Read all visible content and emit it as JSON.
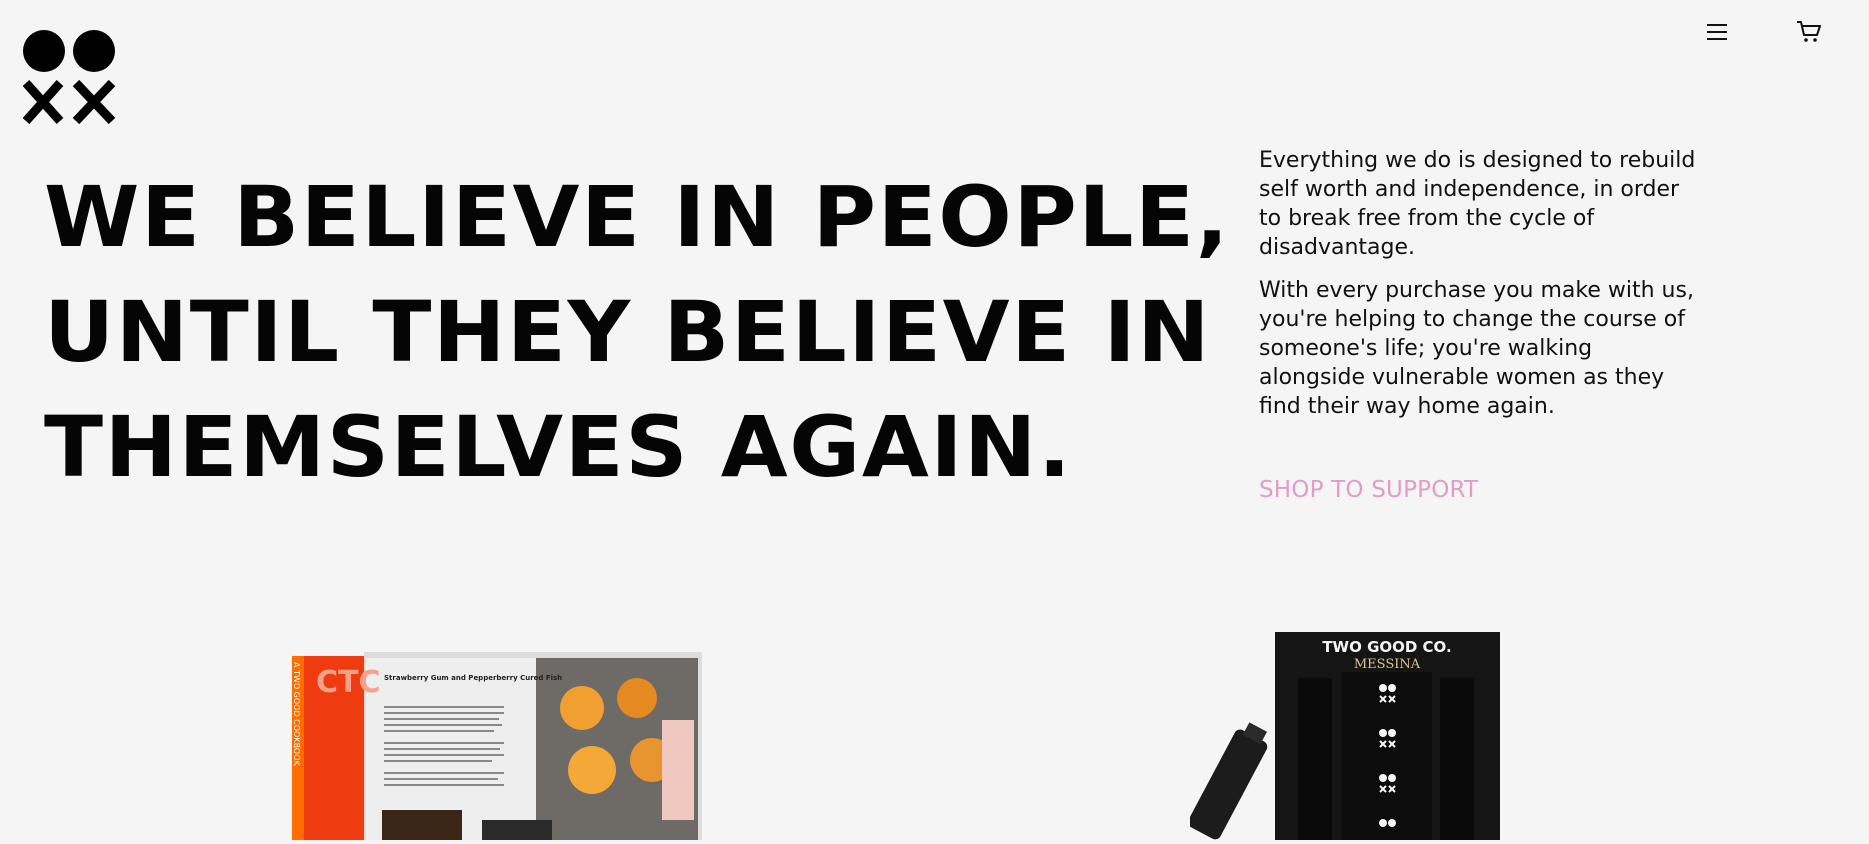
{
  "header": {
    "logo_icon": "two-good-co-logo",
    "menu_icon": "hamburger-menu-icon",
    "cart_icon": "shopping-cart-icon"
  },
  "hero": {
    "headline_lines": [
      "WE BELIEVE IN PEOPLE,",
      "UNTIL THEY BELIEVE IN",
      "THEMSELVES AGAIN."
    ],
    "paragraphs": [
      "Everything we do is designed to rebuild self worth and independence, in order to break free from the cycle of disadvantage.",
      "With every purchase you make with us, you're helping to change the course of someone's life; you're walking alongside vulnerable women as they find their way home again."
    ],
    "cta_label": "SHOP TO SUPPORT",
    "cta_color": "#e59bc7"
  },
  "products": {
    "cookbook": {
      "spine_text": "A TWO GOOD COOKBOOK",
      "cover_letters": "CTC",
      "recipe_title": "Strawberry Gum and Pepperberry Cured Fish"
    },
    "gift_box": {
      "brand": "TWO GOOD CO.",
      "partner": "MESSINA"
    }
  }
}
